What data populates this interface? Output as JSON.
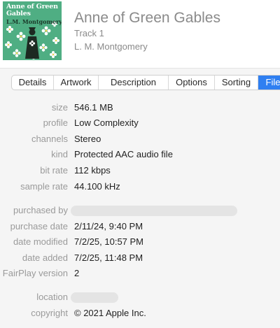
{
  "header": {
    "artwork": {
      "title_line1": "Anne of Green",
      "title_line2": "Gables",
      "author": "L.M. Montgomery",
      "colors": {
        "background": "#4fae83",
        "flowers": "#ffffff"
      }
    },
    "title": "Anne of Green Gables",
    "track": "Track 1",
    "artist": "L. M. Montgomery"
  },
  "tabs": [
    {
      "label": "Details"
    },
    {
      "label": "Artwork"
    },
    {
      "label": "Description"
    },
    {
      "label": "Options"
    },
    {
      "label": "Sorting"
    },
    {
      "label": "File",
      "active": true
    }
  ],
  "file_info": {
    "size": {
      "label": "size",
      "value": "546.1 MB"
    },
    "profile": {
      "label": "profile",
      "value": "Low Complexity"
    },
    "channels": {
      "label": "channels",
      "value": "Stereo"
    },
    "kind": {
      "label": "kind",
      "value": "Protected AAC audio file"
    },
    "bit_rate": {
      "label": "bit rate",
      "value": "112 kbps"
    },
    "sample_rate": {
      "label": "sample rate",
      "value": "44.100 kHz"
    },
    "purchased_by": {
      "label": "purchased by",
      "value": ""
    },
    "purchase_date": {
      "label": "purchase date",
      "value": "2/11/24, 9:40 PM"
    },
    "date_modified": {
      "label": "date modified",
      "value": "7/2/25, 10:57 PM"
    },
    "date_added": {
      "label": "date added",
      "value": "7/2/25, 11:48 PM"
    },
    "fairplay_version": {
      "label": "FairPlay version",
      "value": "2"
    },
    "location": {
      "label": "location",
      "value": ""
    },
    "copyright": {
      "label": "copyright",
      "value": "© 2021 Apple Inc."
    }
  },
  "colors": {
    "accent": "#2f7ff1",
    "label": "#9a9a9a",
    "header_text": "#8a8a8a",
    "redacted": "#e4e4e4"
  }
}
